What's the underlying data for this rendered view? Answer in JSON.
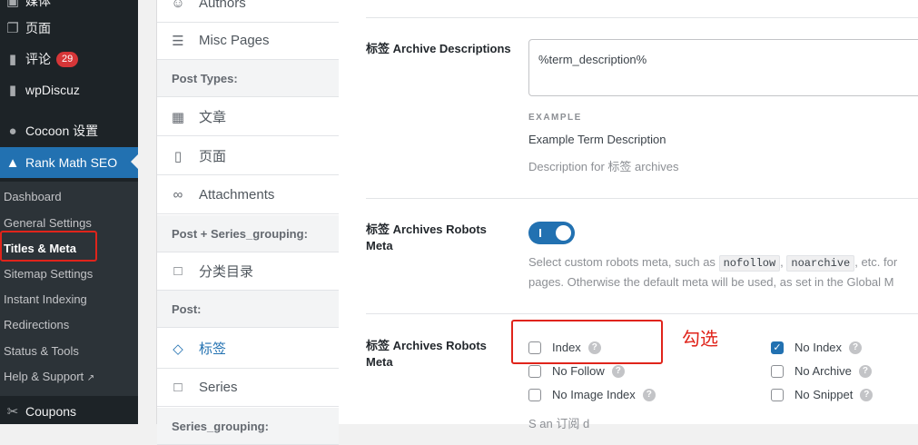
{
  "sidebar": {
    "menu": [
      {
        "label": "媒体",
        "icon": "media-icon"
      },
      {
        "label": "页面",
        "icon": "page-icon"
      },
      {
        "label": "评论",
        "icon": "comment-icon",
        "badge": "29"
      },
      {
        "label": "wpDiscuz",
        "icon": "discuz-icon"
      },
      {
        "label": "Cocoon 设置",
        "icon": "cocoon-icon"
      },
      {
        "label": "Rank Math SEO",
        "icon": "rankmath-icon"
      },
      {
        "label": "Coupons",
        "icon": "coupons-icon"
      }
    ],
    "submenu": [
      "Dashboard",
      "General Settings",
      "Titles & Meta",
      "Sitemap Settings",
      "Instant Indexing",
      "Redirections",
      "Status & Tools",
      "Help & Support"
    ],
    "help_external_icon": "external-link-icon"
  },
  "nav": {
    "items": [
      {
        "label": "Authors",
        "icon": "authors-icon"
      },
      {
        "label": "Misc Pages",
        "icon": "misc-icon"
      },
      {
        "label": "文章",
        "icon": "post-icon"
      },
      {
        "label": "页面",
        "icon": "page-icon"
      },
      {
        "label": "Attachments",
        "icon": "attachment-icon"
      },
      {
        "label": "分类目录",
        "icon": "folder-icon"
      },
      {
        "label": "标签",
        "icon": "tag-icon"
      },
      {
        "label": "Series",
        "icon": "folder-icon"
      }
    ],
    "groups": [
      "Post Types:",
      "Post + Series_grouping:",
      "Post:",
      "Series_grouping:"
    ]
  },
  "settings": {
    "desc_label": "标签 Archive Descriptions",
    "desc_value": "%term_description%",
    "example_head": "EXAMPLE",
    "example_value": "Example Term Description",
    "desc_help": "Description for 标签 archives",
    "robots_toggle_label": "标签 Archives Robots Meta",
    "robots_help_pre": "Select custom robots meta, such as",
    "robots_help_code1": "nofollow",
    "robots_help_code2": "noarchive",
    "robots_help_post": ", etc. for",
    "robots_help_line2": "pages. Otherwise the default meta will be used, as set in the Global M",
    "robots_meta_label": "标签 Archives Robots Meta",
    "checkboxes": {
      "index": "Index",
      "no_index": "No Index",
      "no_follow": "No Follow",
      "no_archive": "No Archive",
      "no_image_index": "No Image Index",
      "no_snippet": "No Snippet"
    },
    "annotation": "勾选",
    "bottom_partial": "S                                          an         订阅                 d"
  },
  "colors": {
    "accent": "#2271b1",
    "annotation": "#e0241b",
    "sidebar": "#1d2327"
  }
}
